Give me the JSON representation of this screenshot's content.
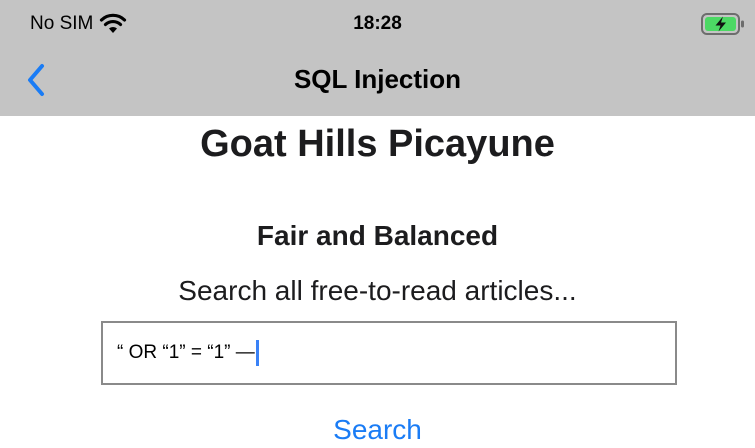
{
  "status_bar": {
    "carrier": "No SIM",
    "wifi_icon": "wifi-icon",
    "time": "18:28",
    "battery_icon": "battery-charging-icon",
    "battery_color": "#4cd964"
  },
  "nav_bar": {
    "back_icon": "chevron-left-icon",
    "title": "SQL Injection",
    "accent_color": "#1a7cf5"
  },
  "main": {
    "headline": "Goat Hills Picayune",
    "subhead": "Fair and Balanced",
    "search_caption": "Search all free-to-read articles...",
    "search_field_value": "“ OR “1” = “1” —",
    "search_button_label": "Search"
  }
}
